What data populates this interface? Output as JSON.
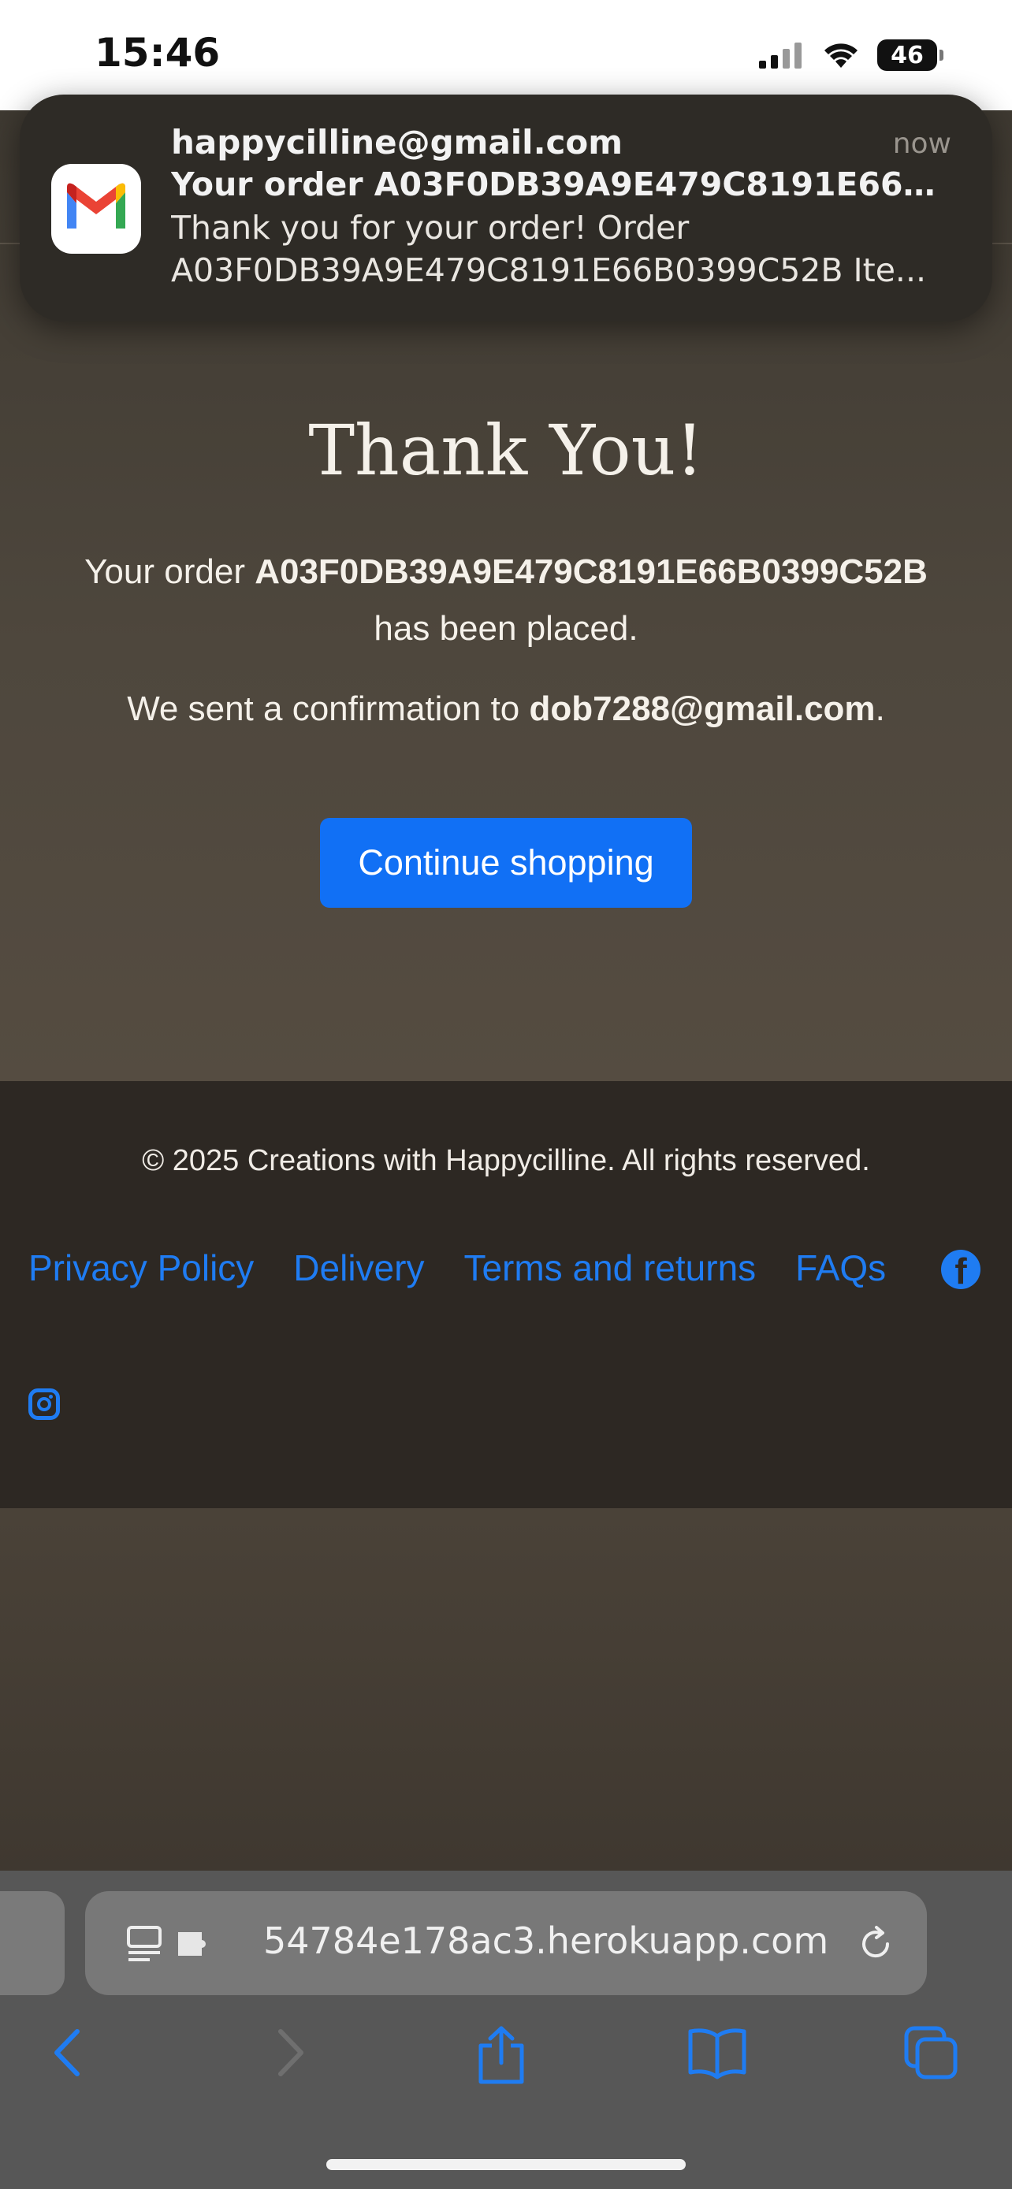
{
  "status_bar": {
    "time": "15:46",
    "battery": "46"
  },
  "notification": {
    "app_icon": "gmail-icon",
    "sender": "happycilline@gmail.com",
    "time": "now",
    "subject": "Your order A03F0DB39A9E479C8191E66B0...",
    "body_line1": "Thank you for your order! Order",
    "body_line2": "A03F0DB39A9E479C8191E66B0399C52B Ite..."
  },
  "main": {
    "title": "Thank You!",
    "order_prefix": "Your order ",
    "order_number": "A03F0DB39A9E479C8191E66B0399C52B",
    "order_suffix": "has been placed.",
    "confirm_prefix": "We sent a confirmation to ",
    "email": "dob7288@gmail.com",
    "confirm_suffix": ".",
    "continue_label": "Continue shopping"
  },
  "footer": {
    "copyright": "© 2025 Creations with Happycilline. All rights reserved.",
    "links": [
      "Privacy Policy",
      "Delivery",
      "Terms and returns",
      "FAQs"
    ],
    "social_icons": [
      "facebook-icon",
      "instagram-icon"
    ],
    "facebook_glyph": "f",
    "link_color": "#1f7cf2"
  },
  "browser": {
    "url": "54784e178ac3.herokuapp.com",
    "nav_icons": [
      "back-icon",
      "forward-icon",
      "share-icon",
      "bookmarks-icon",
      "tabs-icon"
    ]
  },
  "colors": {
    "accent": "#1170f5",
    "footer_bg": "#2d2823",
    "page_bg": "#4a4238"
  }
}
